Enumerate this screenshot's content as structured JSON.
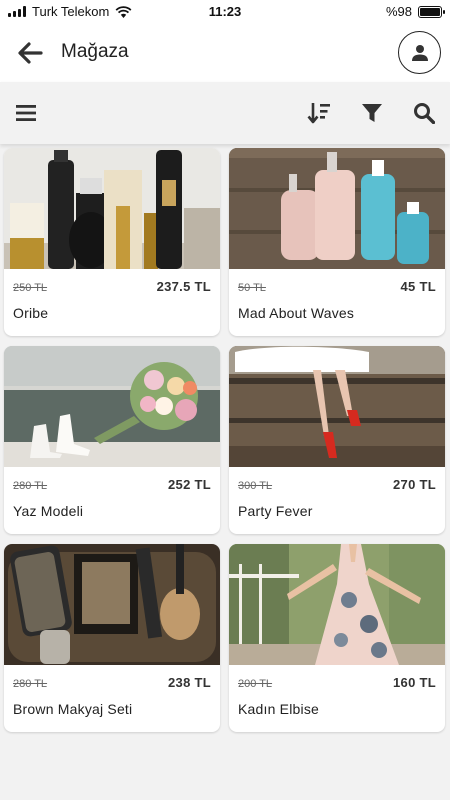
{
  "status_bar": {
    "carrier": "Turk Telekom",
    "time": "11:23",
    "battery": "%98",
    "battery_level": 0.98
  },
  "header": {
    "title": "Mağaza"
  },
  "products": [
    {
      "name": "Oribe",
      "old_price": "250 TL",
      "price": "237.5 TL",
      "image": "hair-product-bottles-photo"
    },
    {
      "name": "Mad About Waves",
      "old_price": "50 TL",
      "price": "45 TL",
      "image": "shampoo-bottles-photo"
    },
    {
      "name": "Yaz Modeli",
      "old_price": "280 TL",
      "price": "252 TL",
      "image": "bridal-shoes-bouquet-photo"
    },
    {
      "name": "Party Fever",
      "old_price": "300 TL",
      "price": "270 TL",
      "image": "red-heels-photo"
    },
    {
      "name": "Brown Makyaj Seti",
      "old_price": "280 TL",
      "price": "238 TL",
      "image": "makeup-kit-photo"
    },
    {
      "name": "Kadın Elbise",
      "old_price": "200 TL",
      "price": "160 TL",
      "image": "floral-dress-photo"
    }
  ],
  "colors": {
    "background": "#f2f2f2",
    "card": "#ffffff",
    "icon": "#333333"
  },
  "icons": {
    "back": "arrow-left-icon",
    "avatar": "user-icon",
    "menu": "hamburger-icon",
    "sort": "sort-descending-icon",
    "filter": "funnel-icon",
    "search": "magnifier-icon"
  }
}
